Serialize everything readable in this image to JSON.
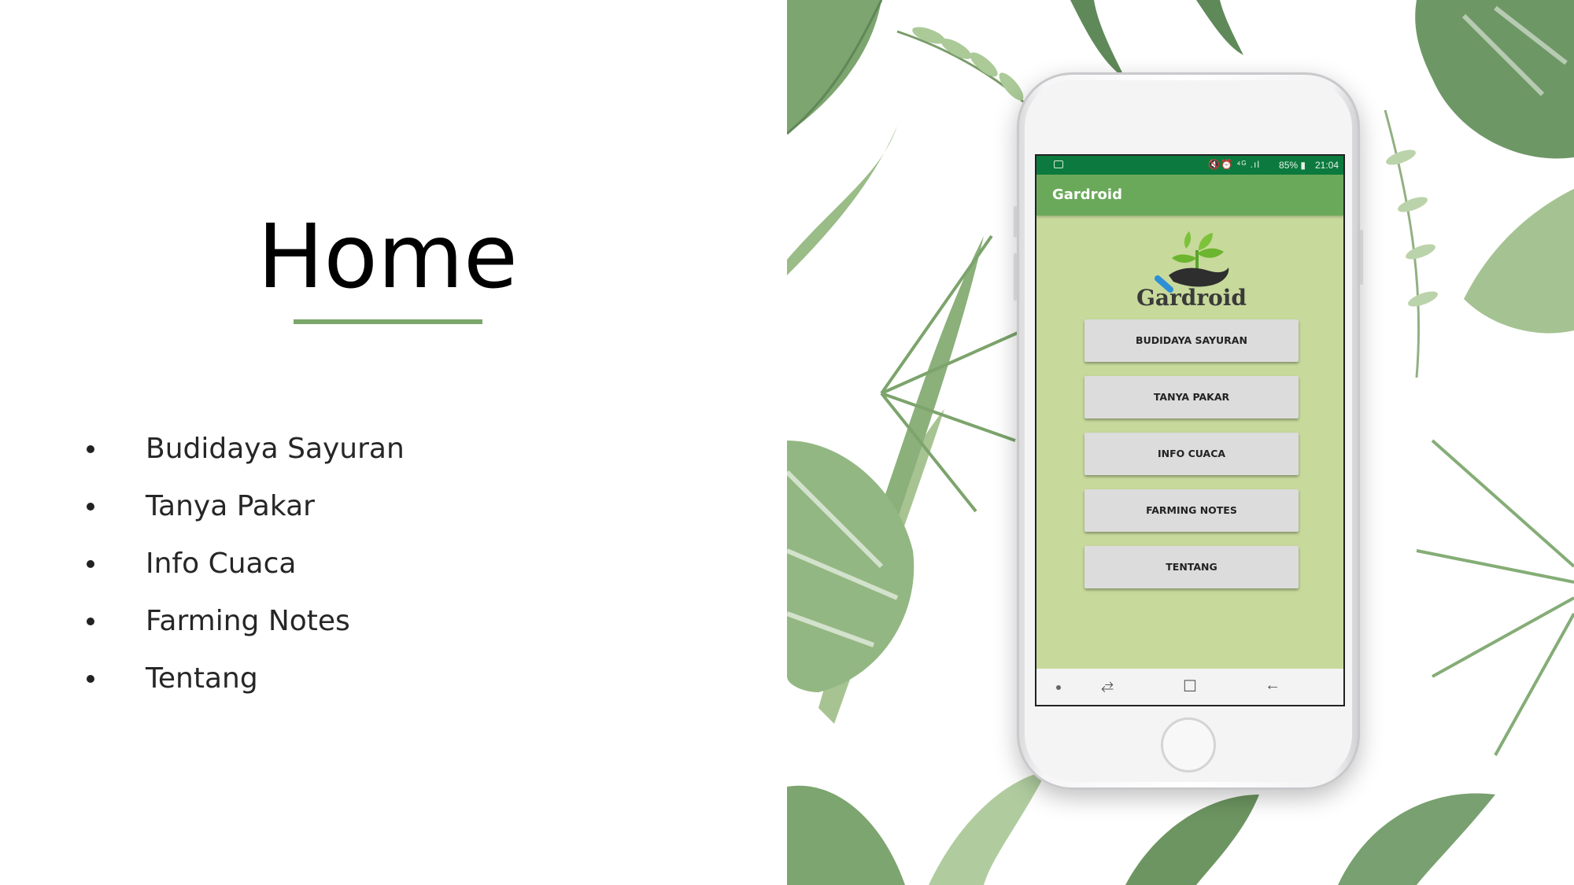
{
  "slide": {
    "title": "Home",
    "bullets": [
      "Budidaya Sayuran",
      "Tanya Pakar",
      "Info Cuaca",
      "Farming Notes",
      "Tentang"
    ]
  },
  "phone": {
    "statusbar": {
      "icons": "🔇⏰ ⁴ᴳ .ıl",
      "battery": "85% ▮",
      "time": "21:04"
    },
    "app_title": "Gardroid",
    "logo_text": "Gardroid",
    "menu": [
      "BUDIDAYA SAYURAN",
      "TANYA PAKAR",
      "INFO CUACA",
      "FARMING NOTES",
      "TENTANG"
    ],
    "navbar": {
      "recent_icon": "⥄",
      "home_icon": "☐",
      "back_icon": "←"
    }
  },
  "colors": {
    "accent_rule": "#7aa76a",
    "statusbar": "#0c7a3e",
    "appbar": "#6ba95a",
    "screen_bg": "#c7d99b"
  }
}
